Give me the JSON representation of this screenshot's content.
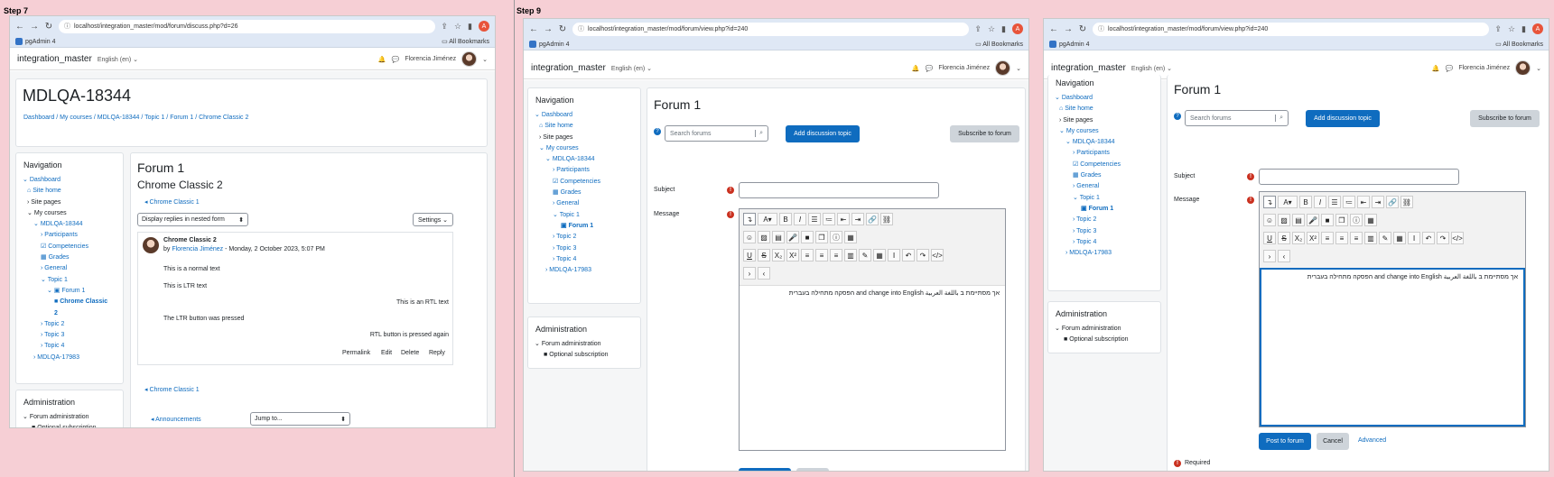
{
  "steps": {
    "a": "Step 7",
    "b": "Step 9"
  },
  "browser": {
    "url1": "localhost/integration_master/mod/forum/discuss.php?d=26",
    "url2": "localhost/integration_master/mod/forum/view.php?id=240",
    "bookmark": "pgAdmin 4",
    "all_bookmarks": "All Bookmarks",
    "profile_letter": "A"
  },
  "moodle": {
    "site": "integration_master",
    "lang": "English (en) ⌄",
    "user": "Florencia Jiménez"
  },
  "nav": {
    "title": "Navigation",
    "dashboard": "Dashboard",
    "site_home": "Site home",
    "site_pages": "Site pages",
    "my_courses": "My courses",
    "course": "MDLQA-18344",
    "participants": "Participants",
    "competencies": "Competencies",
    "grades": "Grades",
    "general": "General",
    "topic1": "Topic 1",
    "forum1": "Forum 1",
    "chrome_classic": "Chrome Classic",
    "chrome_classic_2": "2",
    "topic2": "Topic 2",
    "topic3": "Topic 3",
    "topic4": "Topic 4",
    "other_course": "MDLQA-17983"
  },
  "admin": {
    "title": "Administration",
    "forum_admin": "Forum administration",
    "optional": "Optional subscription"
  },
  "shot1": {
    "page_title": "MDLQA-18344",
    "crumbs": [
      "Dashboard",
      "My courses",
      "MDLQA-18344",
      "Topic 1",
      "Forum 1",
      "Chrome Classic 2"
    ],
    "forum_title": "Forum 1",
    "discussion_title": "Chrome Classic 2",
    "prev_link": "◂ Chrome Classic 1",
    "display_mode": "Display replies in nested form",
    "settings": "Settings ⌄",
    "post_subject": "Chrome Classic 2",
    "post_by": "by ",
    "post_author": "Florencia Jiménez",
    "post_date": " - Monday, 2 October 2023, 5:07 PM",
    "lines": [
      "This is a normal text",
      "This is LTR text",
      "This is an RTL text",
      "The LTR button was pressed",
      "RTL button is pressed again"
    ],
    "actions": [
      "Permalink",
      "Edit",
      "Delete",
      "Reply"
    ],
    "prev_link2": "◂ Chrome Classic 1",
    "announcements": "◂ Announcements",
    "jump": "Jump to..."
  },
  "form": {
    "title": "Forum 1",
    "search_placeholder": "Search forums",
    "add_topic": "Add discussion topic",
    "subscribe": "Subscribe to forum",
    "subject": "Subject",
    "message": "Message",
    "text": "אך מסתיימת ב باللغة العربية and change into English הפסקה מתחילה בעברית",
    "post": "Post to forum",
    "cancel": "Cancel",
    "advanced": "Advanced",
    "required": "Required"
  },
  "colors": {
    "accent": "#0f6cbf",
    "background": "#f6cfd5",
    "required": "#ca3120"
  }
}
